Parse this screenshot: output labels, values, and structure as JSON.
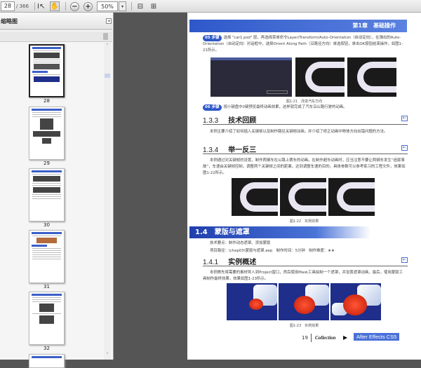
{
  "toolbar": {
    "page_current": "28",
    "page_total": "/ 366",
    "zoom": "50%"
  },
  "sidebar": {
    "title": "缩略图",
    "thumbnails": [
      {
        "label": "28"
      },
      {
        "label": "29"
      },
      {
        "label": "30"
      },
      {
        "label": "31"
      },
      {
        "label": "32"
      }
    ]
  },
  "page": {
    "chapter": "第1章　基础操作",
    "step05": {
      "badge": "05 步骤",
      "text": "选择 \"car1.psd\" 层，再选择菜单命令Layer/Transform/Auto-Orientation（自动定向），在弹出的Auto-Orientation（自动定向）对话框中，选择Orient Along Path（沿路径方向）单选按钮，单击OK按钮结束操作，如图1-21所示。"
    },
    "fig21_caption": "图1-21　改变汽车方向",
    "step06": {
      "badge": "06 步骤",
      "text": "按小键盘中0键预览最终动画效果，这样就完成了汽车沿公路行驶的动画。"
    },
    "sec133": {
      "num": "1.3.3",
      "title": "技术回顾",
      "text": "本例主要介绍了如何插入关键帧以及制作路径关键帧动画，并介绍了修正动画中物体方向出错问题的方法。"
    },
    "sec134": {
      "num": "1.3.4",
      "title": "举一反三",
      "text": "本例通过对关键帧的设置，制作两辆车在公路上赛车的动画。在制作超车动画时，应当注意不要让两辆车发生“追尾事故”，车速由关键帧控制，调整两个关键帧之间的距离，达到调整车速的目的。具体参数可以参考练习的工程文件，效果如图1-22所示。"
    },
    "fig22_caption": "图1-22　实例效果",
    "sec14": {
      "title": "1.4　蒙版与遮罩",
      "key_points": "技术要点：制作动态遮罩、添加蒙版",
      "project": "项目路径：\\chap03\\蒙版与遮罩.aep　制作时间：5分钟　制作难度：★★"
    },
    "sec141": {
      "num": "1.4.1",
      "title": "实例概述",
      "text": "本例首先将需要的素材导入到Project窗口，然后使用Mask工具绘制一个遮罩，并设置遮罩动画，最后，使用蒙版工具制作最终效果，效果如图1-23所示。"
    },
    "fig23_caption": "图1-23　实例效果",
    "footer": {
      "page_number": "19",
      "collection": "Collection",
      "product": "After Effects CS5"
    }
  },
  "colors": {
    "accent": "#2e58c9"
  }
}
